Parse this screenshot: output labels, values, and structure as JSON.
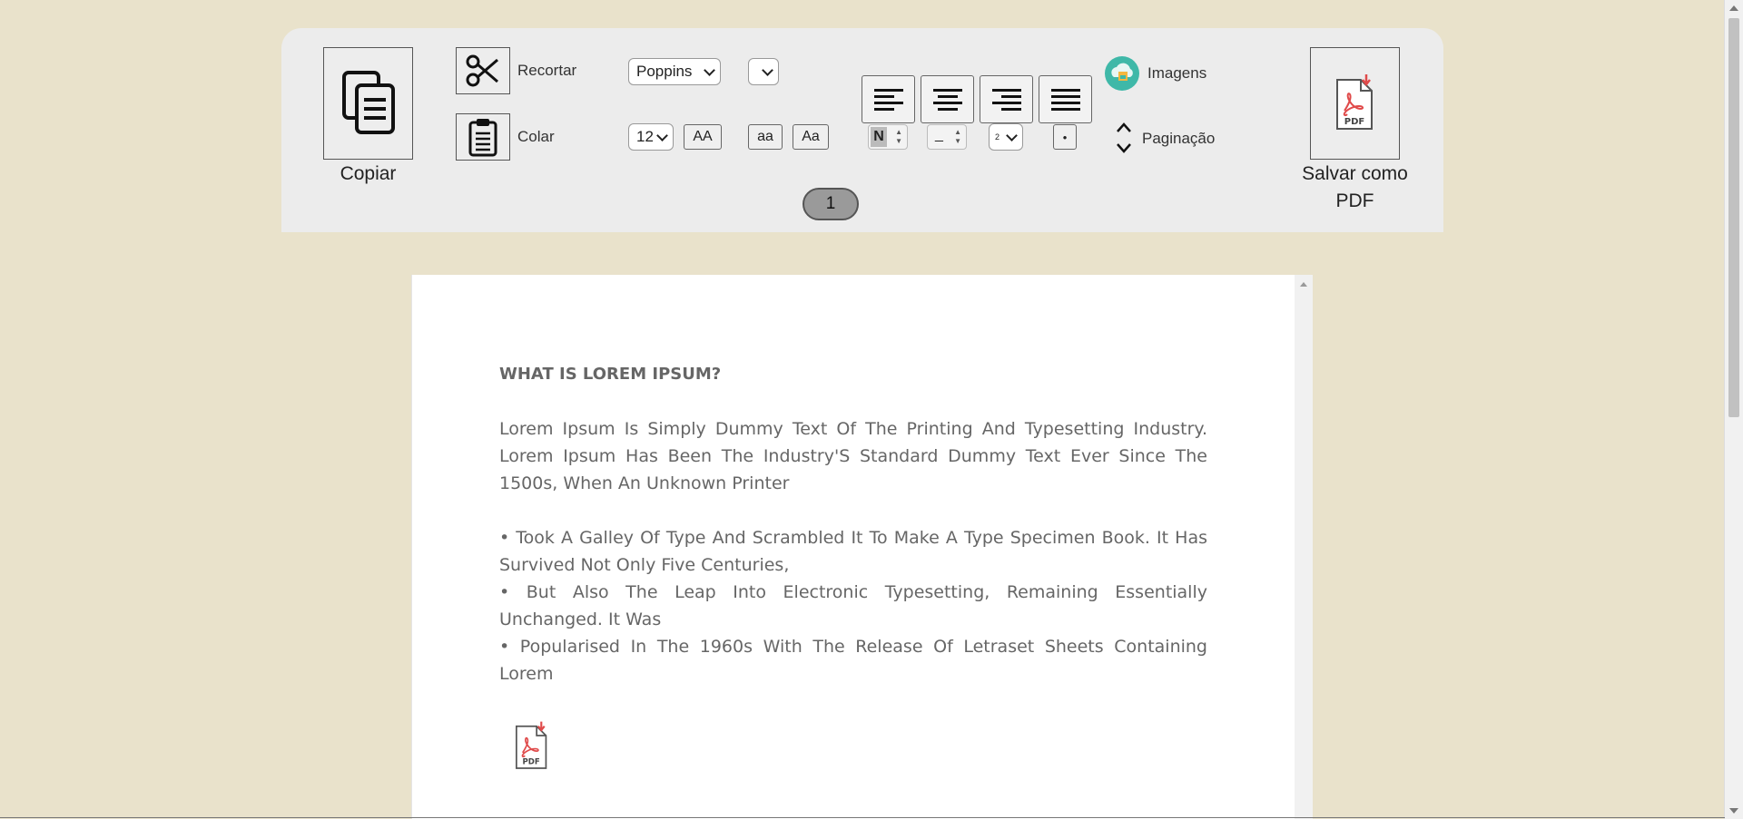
{
  "toolbar": {
    "copy_label": "Copiar",
    "cut_label": "Recortar",
    "paste_label": "Colar",
    "font_family": "Poppins",
    "font_size": "12",
    "btn_upper": "AA",
    "btn_lower": "aa",
    "btn_capitalize": "Aa",
    "bold_label": "N",
    "indent_value": "_",
    "line_spacing": "2",
    "bullet_label": "•",
    "images_label": "Imagens",
    "pagination_label": "Paginação",
    "save_pdf_label": "Salvar como PDF",
    "page_number": "1"
  },
  "icons": {
    "copy": "copy-icon",
    "cut": "scissors-icon",
    "paste": "clipboard-icon",
    "align_left": "align-left-icon",
    "align_center": "align-center-icon",
    "align_right": "align-right-icon",
    "align_justify": "align-justify-icon",
    "images": "image-upload-icon",
    "pagination": "up-down-chevron-icon",
    "pdf": "pdf-icon"
  },
  "colors": {
    "background": "#e9e2cb",
    "toolbar": "#ececec",
    "page_badge": "#9a9a9a",
    "pdf_red": "#e04a4a",
    "images_teal": "#3fb8a8"
  },
  "document": {
    "heading": "WHAT IS LOREM IPSUM?",
    "paragraph": "Lorem Ipsum Is Simply Dummy Text Of The Printing And Typesetting Industry. Lorem Ipsum Has Been The Industry'S Standard Dummy Text Ever Since The 1500s, When An Unknown Printer",
    "bullets": [
      "• Took A Galley Of Type And Scrambled It To Make A Type Specimen Book. It Has Survived Not Only Five Centuries,",
      "• But Also The Leap Into Electronic Typesetting, Remaining Essentially Unchanged. It Was",
      "• Popularised In The 1960s With The Release Of Letraset Sheets Containing Lorem"
    ]
  }
}
